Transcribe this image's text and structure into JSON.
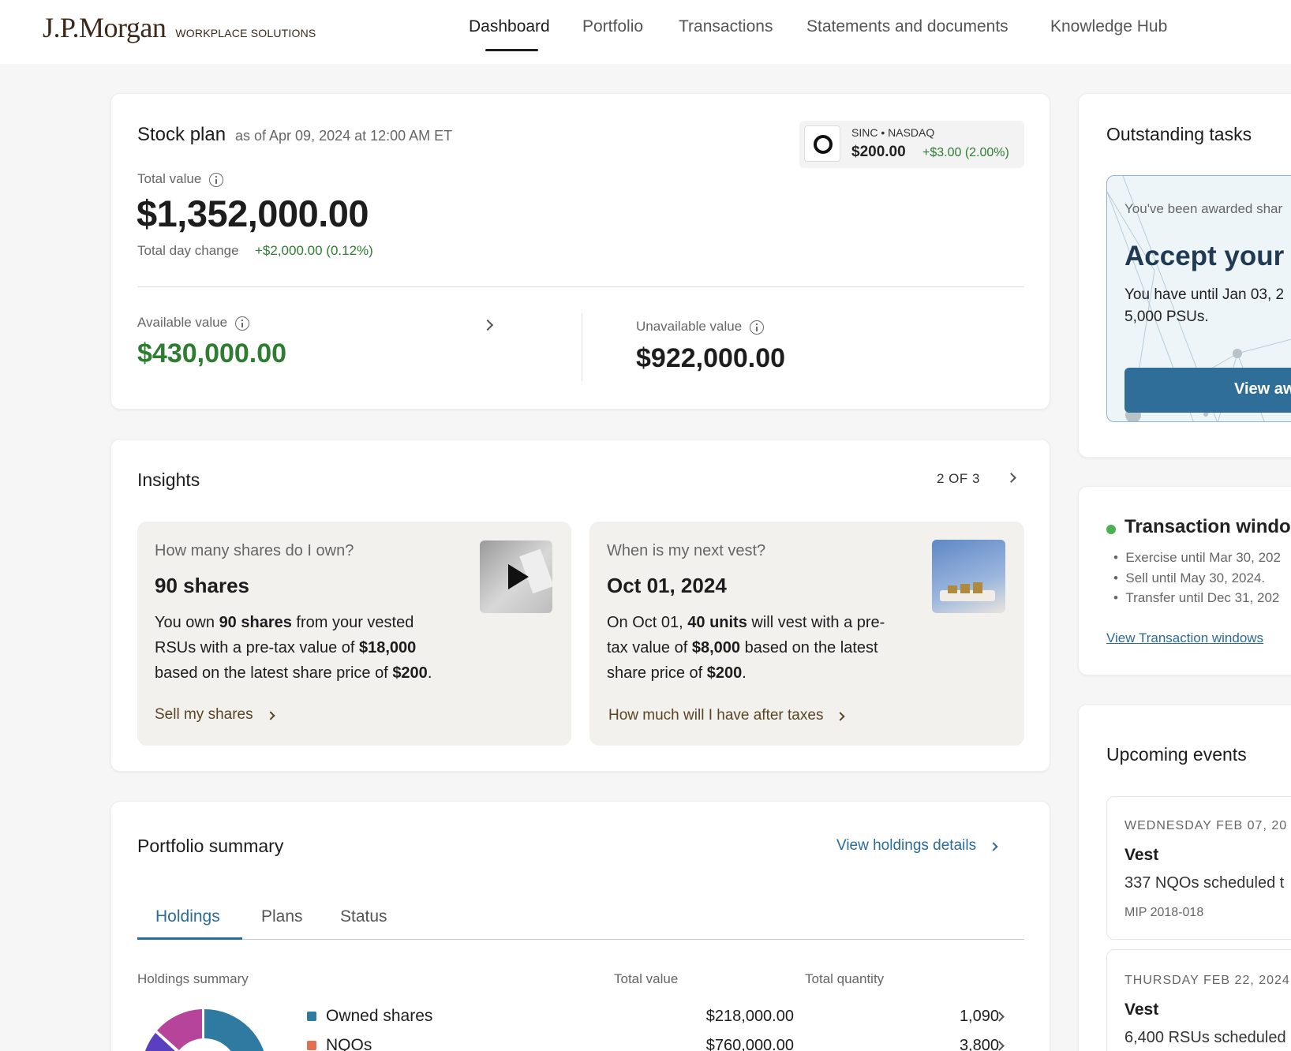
{
  "header": {
    "logo": "J.P.Morgan",
    "logo_sub": "WORKPLACE SOLUTIONS",
    "nav": [
      "Dashboard",
      "Portfolio",
      "Transactions",
      "Statements and documents",
      "Knowledge Hub"
    ]
  },
  "stock_plan": {
    "title": "Stock plan",
    "as_of": "as of Apr 09, 2024 at 12:00 AM ET",
    "ticker_line": "SINC • NASDAQ",
    "price": "$200.00",
    "price_change": "+$3.00 (2.00%)",
    "total_value_label": "Total value",
    "total_value": "$1,352,000.00",
    "day_change_label": "Total day change",
    "day_change": "+$2,000.00 (0.12%)",
    "available_label": "Available value",
    "available_value": "$430,000.00",
    "unavailable_label": "Unavailable value",
    "unavailable_value": "$922,000.00"
  },
  "insights": {
    "title": "Insights",
    "pager": "2 OF 3",
    "tiles": [
      {
        "question": "How many shares do I own?",
        "headline": "90 shares",
        "body_parts": [
          "You own ",
          "90 shares",
          " from your vested",
          "RSUs with a pre-tax value of ",
          "$18,000",
          "based on the latest share price of ",
          "$200",
          "."
        ],
        "link": "Sell my shares"
      },
      {
        "question": "When is my next vest?",
        "headline": "Oct 01, 2024",
        "body_parts": [
          "On Oct 01, ",
          "40 units",
          " will vest with a pre-",
          "tax value of ",
          "$8,000",
          " based on the latest",
          "share price of ",
          "$200",
          "."
        ],
        "link": "How much will I have after taxes"
      }
    ]
  },
  "portfolio": {
    "title": "Portfolio summary",
    "view_link": "View holdings details",
    "tabs": [
      "Holdings",
      "Plans",
      "Status"
    ],
    "col_summary": "Holdings summary",
    "col_value": "Total value",
    "col_qty": "Total quantity",
    "rows": [
      {
        "name": "Owned shares",
        "value": "$218,000.00",
        "qty": "1,090",
        "color": "#2f7aa0"
      },
      {
        "name": "NQOs",
        "value": "$760,000.00",
        "qty": "3,800",
        "color": "#e2704f"
      }
    ],
    "donut_colors": [
      "#2f7aa0",
      "#b5449a",
      "#5a3fc0"
    ]
  },
  "tasks": {
    "title": "Outstanding tasks",
    "awarded": "You've been awarded shar",
    "headline": "Accept your a",
    "body1": "You have until Jan 03, 2",
    "body2": "5,000 PSUs.",
    "button": "View aw"
  },
  "transaction_windows": {
    "title": "Transaction windo",
    "items": [
      "Exercise until Mar 30, 202",
      "Sell until May 30, 2024.",
      "Transfer until Dec 31, 202"
    ],
    "link": "View Transaction windows"
  },
  "events": {
    "title": "Upcoming events",
    "items": [
      {
        "date": "WEDNESDAY FEB 07, 20",
        "type": "Vest",
        "desc": "337 NQOs scheduled t",
        "plan": "MIP 2018-018"
      },
      {
        "date": "THURSDAY FEB 22, 2024",
        "type": "Vest",
        "desc": "6,400 RSUs scheduled"
      }
    ]
  },
  "colors": {
    "accent_blue": "#2a6b99",
    "positive_green": "#2e7d32",
    "button_blue": "#2e6e99"
  }
}
